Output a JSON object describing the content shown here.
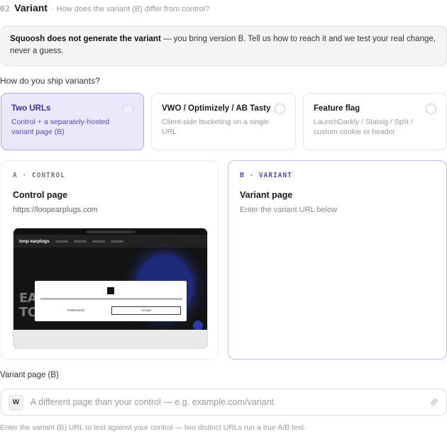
{
  "header": {
    "step": "02",
    "title": "Variant",
    "subtitle": "· How does the variant (B) differ from control?"
  },
  "notice": {
    "bold": "Squoosh does not generate the variant",
    "rest": " — you bring version B. Tell us how to reach it and we test your real change, never a guess."
  },
  "ship_question": "How do you ship variants?",
  "options": [
    {
      "title": "Two URLs",
      "desc": "Control + a separately-hosted variant page (B)",
      "selected": true
    },
    {
      "title": "VWO / Optimizely / AB Tasty",
      "desc": "Client-side bucketing on a single URL",
      "selected": false
    },
    {
      "title": "Feature flag",
      "desc": "LaunchDarkly / Statsig / Split / custom cookie or header",
      "selected": false
    }
  ],
  "control_card": {
    "tag": "A · CONTROL",
    "title": "Control page",
    "url": "https://loopearplugs.com",
    "thumbnail": {
      "logo": "loop earplugs",
      "hero_text": "EARPLUGS OF\nTOMORROWLAND",
      "modal_preferences": "Preferences",
      "modal_accept": "Accept"
    }
  },
  "variant_card": {
    "tag": "B · VARIANT",
    "title": "Variant page",
    "hint": "Enter the variant URL below"
  },
  "variant_field": {
    "label": "Variant page (B)",
    "icon_letter": "W",
    "placeholder": "A different page than your control — e.g. example.com/variant",
    "value": "",
    "helper": "Enter the variant (B) URL to test against your control — two distinct URLs run a true A/B test."
  },
  "colors": {
    "accent": "#5b46c4",
    "selected_bg": "#ece8fb"
  },
  "icons": {
    "radio": "radio-circle",
    "link": "link-icon",
    "favicon": "w-letter-icon"
  }
}
